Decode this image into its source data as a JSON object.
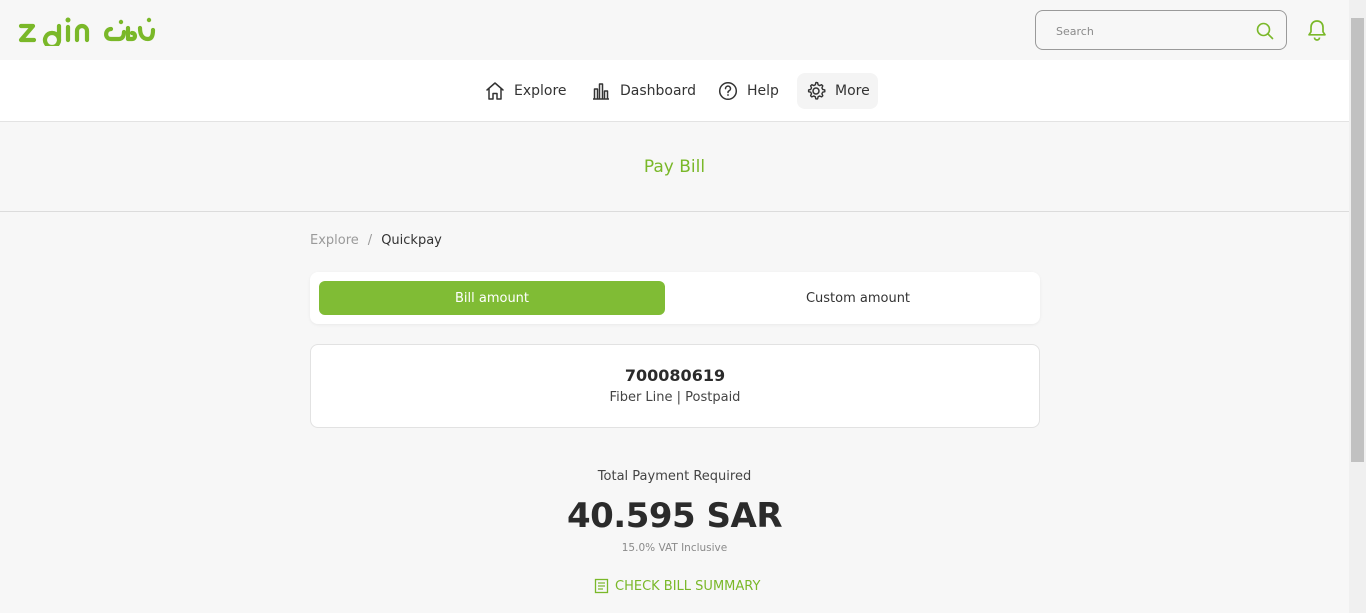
{
  "header": {
    "logo_text": "zain زين",
    "search_placeholder": "Search",
    "icons": {
      "search": "search-icon",
      "notifications": "bell-icon"
    }
  },
  "nav": {
    "items": [
      {
        "label": "Explore",
        "icon": "home-icon"
      },
      {
        "label": "Dashboard",
        "icon": "bar-chart-icon"
      },
      {
        "label": "Help",
        "icon": "question-circle-icon"
      },
      {
        "label": "More",
        "icon": "gear-icon",
        "active": true
      }
    ]
  },
  "page": {
    "title": "Pay Bill",
    "breadcrumb": {
      "parent": "Explore",
      "separator": "/",
      "current": "Quickpay"
    }
  },
  "amount_toggle": {
    "options": [
      "Bill amount",
      "Custom amount"
    ],
    "selected": "Bill amount"
  },
  "account": {
    "number": "700080619",
    "type": "Fiber Line | Postpaid"
  },
  "payment": {
    "label": "Total Payment Required",
    "amount": "40.595 SAR",
    "vat_note": "15.0% VAT Inclusive",
    "summary_link": "CHECK BILL SUMMARY",
    "summary_icon": "document-icon"
  },
  "colors": {
    "brand_green": "#80bc35",
    "title_green": "#7ab829",
    "background": "#f7f7f7"
  }
}
